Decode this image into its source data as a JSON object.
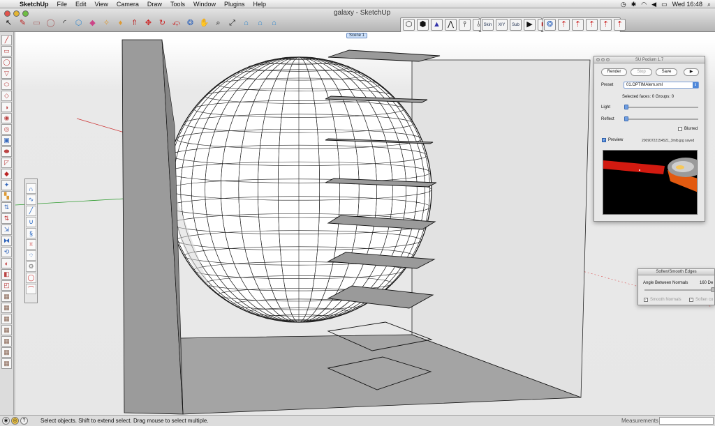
{
  "menubar": {
    "app_name": "SketchUp",
    "items": [
      "File",
      "Edit",
      "View",
      "Camera",
      "Draw",
      "Tools",
      "Window",
      "Plugins",
      "Help"
    ],
    "clock": "Wed 16:48"
  },
  "window": {
    "title": "galaxy - SketchUp"
  },
  "toolbar": {
    "skin_label": "Skin",
    "xy_label": "X/Y",
    "sub_label": "Sub"
  },
  "scene": {
    "tab_label": "Scene 1"
  },
  "podium": {
    "title": "SU Podium 1.7",
    "render_label": "Render",
    "stop_label": "Stop",
    "save_label": "Save",
    "play_label": "▶",
    "preset_label": "Preset",
    "preset_value": "01.OPTIMAlem.xml",
    "selected_info": "Selected faces: 0  Groups: 0",
    "light_label": "Light",
    "reflect_label": "Reflect",
    "blurred_label": "Blurred",
    "preview_label": "Preview",
    "saved_file": "20090722154521_3mlb.jpg saved",
    "preview_checked": "✓"
  },
  "soften": {
    "title": "Soften/Smooth Edges",
    "angle_label": "Angle Between Normals",
    "angle_value": "160 De",
    "smooth_normals": "Smooth Normals",
    "soften_coplanar": "Soften co"
  },
  "status": {
    "text": "Select objects. Shift to extend select. Drag mouse to select multiple.",
    "measurements_label": "Measurements"
  },
  "colors": {
    "wall": "#9b9b9b",
    "floor": "#a4a4a4",
    "panel_bg": "#e8e8e8",
    "accent": "#4d87d9"
  }
}
